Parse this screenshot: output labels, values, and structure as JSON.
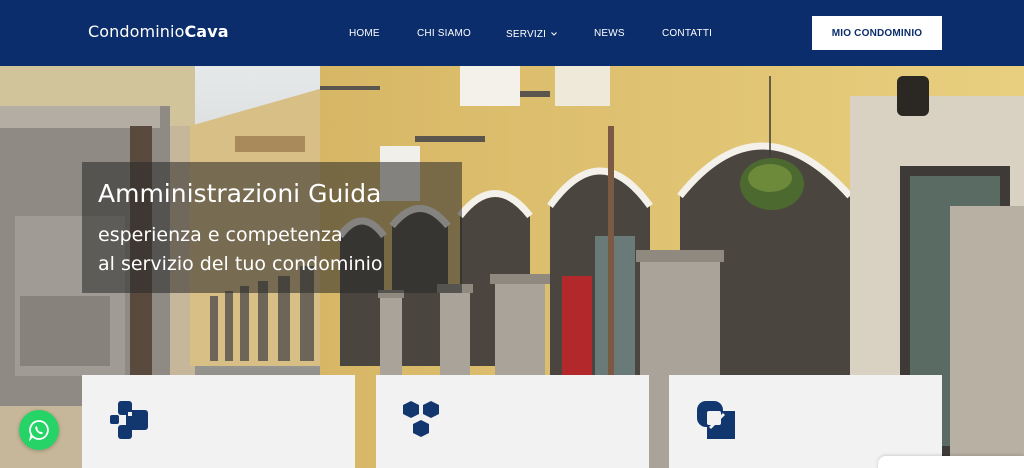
{
  "brand": {
    "logo_regular": "Condominio",
    "logo_bold": "Cava"
  },
  "nav": {
    "home": "HOME",
    "chi_siamo": "CHI SIAMO",
    "servizi": "SERVIZI",
    "news": "NEWS",
    "contatti": "CONTATTI",
    "cta": "MIO CONDOMINIO"
  },
  "hero": {
    "title": "Amministrazioni Guida",
    "subtitle_line1": "esperienza e competenza",
    "subtitle_line2": "al servizio del tuo condominio"
  },
  "cards": [
    {
      "icon": "blocks-icon"
    },
    {
      "icon": "hexagons-icon"
    },
    {
      "icon": "squares-overlap-icon"
    }
  ],
  "floating": {
    "chat_icon": "whatsapp-icon"
  },
  "colors": {
    "brand_navy": "#0b2d6b",
    "card_bg": "#f2f2f2",
    "whatsapp_green": "#25d366",
    "icon_navy": "#12376f"
  }
}
